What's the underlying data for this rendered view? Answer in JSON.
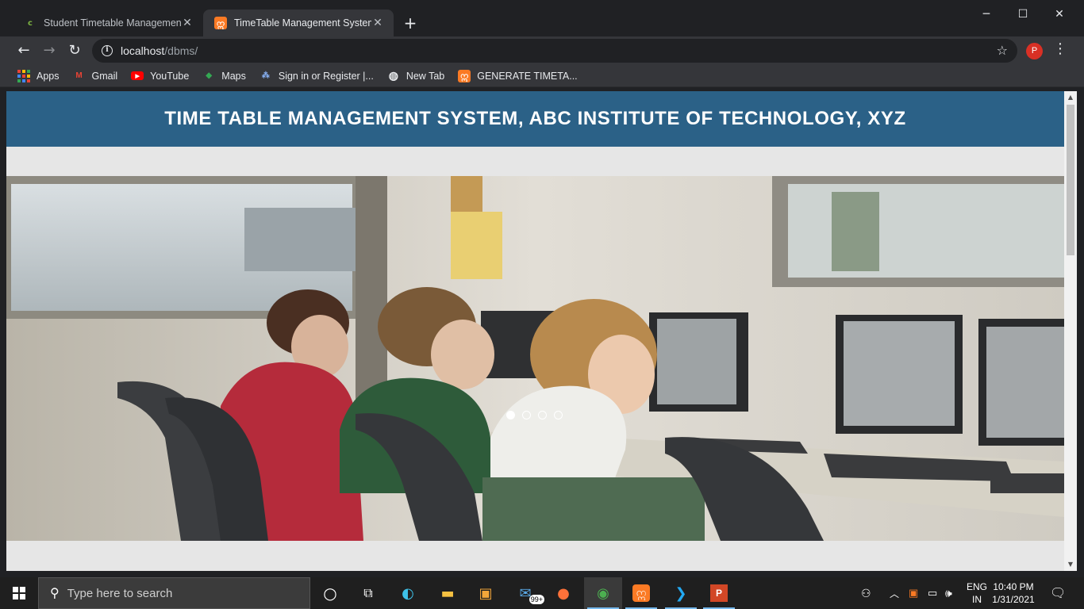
{
  "browser": {
    "tabs": [
      {
        "title": "Student Timetable Management",
        "favicon": "leaf-favicon",
        "active": false
      },
      {
        "title": "TimeTable Management System",
        "favicon": "xampp-favicon",
        "active": true
      }
    ],
    "new_tab_label": "+",
    "window_controls": {
      "minimize": "─",
      "maximize": "☐",
      "close": "✕"
    },
    "nav": {
      "back": "←",
      "forward": "→",
      "reload": "↻"
    },
    "url_host": "localhost",
    "url_path": "/dbms/",
    "info_icon": "i",
    "star_icon": "☆",
    "profile_initial": "P",
    "menu_icon": "⋮"
  },
  "bookmarks": [
    {
      "label": "Apps",
      "icon": "apps-grid-icon"
    },
    {
      "label": "Gmail",
      "icon": "gmail-icon",
      "glyph": "M",
      "color": "#ea4335"
    },
    {
      "label": "YouTube",
      "icon": "youtube-icon",
      "glyph": "▶",
      "color": "#ff0000"
    },
    {
      "label": "Maps",
      "icon": "maps-icon",
      "glyph": "◆",
      "color": "#34a853"
    },
    {
      "label": "Sign in or Register |...",
      "icon": "site-icon",
      "glyph": "⁂",
      "color": "#8ab4f8"
    },
    {
      "label": "New Tab",
      "icon": "globe-icon",
      "glyph": "◍",
      "color": "#e8eaed"
    },
    {
      "label": "GENERATE TIMETA...",
      "icon": "xampp-icon",
      "glyph": "ဣ",
      "color": "#fb7a24"
    }
  ],
  "page": {
    "title": "TIME TABLE MANAGEMENT SYSTEM, ABC INSTITUTE OF TECHNOLOGY, XYZ",
    "header_color": "#2b6187",
    "carousel": {
      "slides": 4,
      "active_index": 0,
      "image": "students-at-computers-photo"
    }
  },
  "taskbar": {
    "search_placeholder": "Type here to search",
    "lang_top": "ENG",
    "lang_bottom": "IN",
    "time": "10:40 PM",
    "date": "1/31/2021",
    "mail_badge": "99+"
  }
}
